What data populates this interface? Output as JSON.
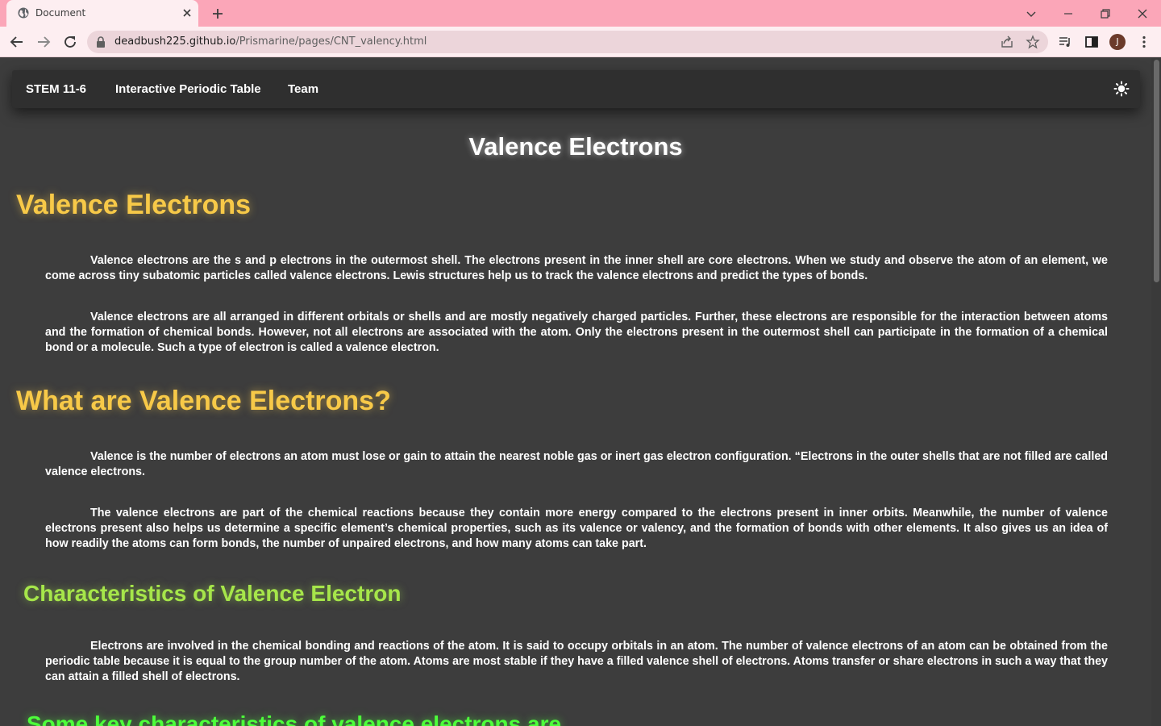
{
  "browser": {
    "tab_title": "Document",
    "url_host": "deadbush225.github.io",
    "url_path": "/Prismarine/pages/CNT_valency.html",
    "profile_initial": "J"
  },
  "navbar": {
    "links": [
      "STEM 11-6",
      "Interactive Periodic Table",
      "Team"
    ]
  },
  "page": {
    "title": "Valence Electrons",
    "sections": [
      {
        "heading": "Valence Electrons",
        "paragraphs": [
          "Valence electrons are the s and p electrons in the outermost shell. The electrons present in the inner shell are core electrons. When we study and observe the atom of an element, we come across tiny subatomic particles called valence electrons. Lewis structures help us to track the valence electrons and predict the types of bonds.",
          "Valence electrons are all arranged in different orbitals or shells and are mostly negatively charged particles. Further, these electrons are responsible for the interaction between atoms and the formation of chemical bonds. However, not all electrons are associated with the atom. Only the electrons present in the outermost shell can participate in the formation of a chemical bond or a molecule. Such a type of electron is called a valence electron."
        ]
      },
      {
        "heading": "What are Valence Electrons?",
        "paragraphs": [
          "Valence is the number of electrons an atom must lose or gain to attain the nearest noble gas or inert gas electron configuration. “Electrons in the outer shells that are not filled are called valence electrons.",
          "The valence electrons are part of the chemical reactions because they contain more energy compared to the electrons present in inner orbits. Meanwhile, the number of valence electrons present also helps us determine a specific element’s chemical properties, such as its valence or valency, and the formation of bonds with other elements. It also gives us an idea of how readily the atoms can form bonds, the number of unpaired electrons, and how many atoms can take part."
        ]
      },
      {
        "heading": "Characteristics of Valence Electron",
        "paragraphs": [
          "Electrons are involved in the chemical bonding and reactions of the atom. It is said to occupy orbitals in an atom. The number of valence electrons of an atom can be obtained from the periodic table because it is equal to the group number of the atom. Atoms are most stable if they have a filled valence shell of electrons. Atoms transfer or share electrons in such a way that they can attain a filled shell of electrons."
        ]
      },
      {
        "heading": "Some key characteristics of valence electrons are"
      }
    ]
  },
  "colors": {
    "page_bg": "#3d3d3d",
    "navbar_bg": "#2f2f2f",
    "heading_yellow": "#f7c948",
    "heading_green": "#a6e64a",
    "heading_bright_green": "#4dff3a",
    "tabstrip_bg": "#fba6b8"
  },
  "icons": [
    "globe-icon",
    "close-icon",
    "plus-icon",
    "chevron-down-icon",
    "minimize-icon",
    "restore-icon",
    "back-arrow-icon",
    "forward-arrow-icon",
    "reload-icon",
    "lock-icon",
    "share-icon",
    "star-icon",
    "media-icon",
    "sidepanel-icon",
    "kebab-menu-icon",
    "sun-icon"
  ]
}
